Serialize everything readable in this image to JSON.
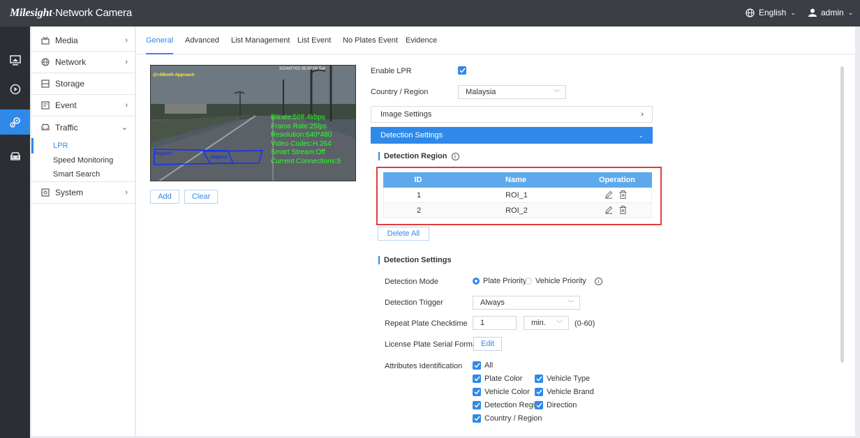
{
  "topbar": {
    "brand": "Milesight",
    "product": "·Network Camera",
    "language": "English",
    "user": "admin"
  },
  "sidebar": {
    "items": [
      {
        "label": "Media",
        "icon": "media-icon"
      },
      {
        "label": "Network",
        "icon": "globe-icon"
      },
      {
        "label": "Storage",
        "icon": "storage-icon"
      },
      {
        "label": "Event",
        "icon": "event-icon"
      },
      {
        "label": "Traffic",
        "icon": "car-icon"
      },
      {
        "label": "System",
        "icon": "system-icon"
      }
    ],
    "traffic_sub": [
      "LPR",
      "Speed Monitoring",
      "Smart Search"
    ]
  },
  "tabs": [
    "General",
    "Advanced",
    "List Management",
    "List Event",
    "No Plates Event",
    "Evidence"
  ],
  "preview": {
    "osd_speed": "@<45km/h Approach",
    "osd_time": "2024/07/02 05:00:00 Sat",
    "stats": [
      "Bitrate:568.4kbps",
      "Frame Rate:25fps",
      "Resolution:640*480",
      "Video Codec:H.264",
      "Smart Stream:Off",
      "Current Connections:5"
    ],
    "regions": [
      "Region1",
      "Region2"
    ]
  },
  "preview_buttons": {
    "add": "Add",
    "clear": "Clear"
  },
  "form": {
    "enable_lpr_label": "Enable LPR",
    "country_label": "Country / Region",
    "country_value": "Malaysia",
    "image_settings": "Image Settings",
    "detection_settings_panel": "Detection Settings",
    "detection_region_heading": "Detection Region",
    "table": {
      "headers": [
        "ID",
        "Name",
        "Operation"
      ],
      "rows": [
        {
          "id": "1",
          "name": "ROI_1"
        },
        {
          "id": "2",
          "name": "ROI_2"
        }
      ]
    },
    "delete_all": "Delete All",
    "detection_settings_heading": "Detection Settings",
    "detection_mode_label": "Detection Mode",
    "mode_options": [
      "Plate Priority",
      "Vehicle Priority"
    ],
    "detection_trigger_label": "Detection Trigger",
    "trigger_value": "Always",
    "repeat_label": "Repeat Plate Checktime",
    "repeat_value": "1",
    "repeat_unit": "min.",
    "repeat_range": "(0-60)",
    "serial_label": "License Plate Serial Format",
    "edit_label": "Edit",
    "attributes_label": "Attributes Identification",
    "attributes": [
      "All",
      "Plate Color",
      "Vehicle Type",
      "Vehicle Color",
      "Vehicle Brand",
      "Detection Region",
      "Direction",
      "Country / Region"
    ]
  },
  "colors": {
    "accent": "#2f89e8",
    "topbar": "#3b3f45",
    "highlight": "#e23b3b"
  }
}
